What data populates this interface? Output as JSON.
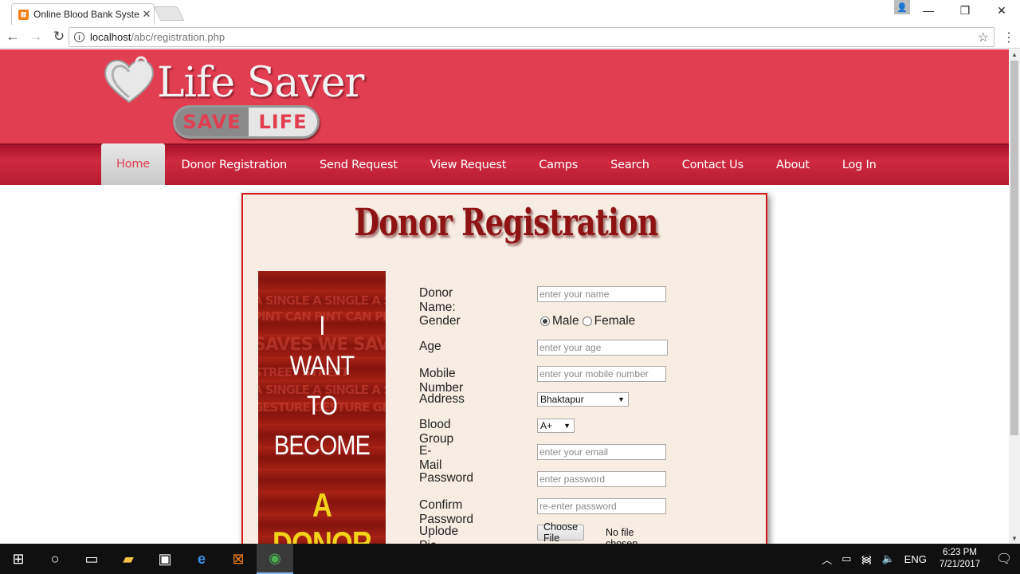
{
  "browser": {
    "tab_title": "Online Blood Bank System",
    "tab_close": "✕",
    "url_host": "localhost",
    "url_path": "/abc/registration.php",
    "back": "←",
    "forward": "→",
    "reload": "C",
    "minimize": "—",
    "restore": "❐",
    "close": "✕"
  },
  "header": {
    "logo_title": "Life Saver",
    "logo_pill_left": "SAVE",
    "logo_pill_right": "LIFE"
  },
  "nav": {
    "items": [
      {
        "label": "Home",
        "active": true
      },
      {
        "label": "Donor Registration"
      },
      {
        "label": "Send Request"
      },
      {
        "label": "View Request"
      },
      {
        "label": "Camps"
      },
      {
        "label": "Search"
      },
      {
        "label": "Contact Us"
      },
      {
        "label": "About"
      },
      {
        "label": "Log In"
      }
    ]
  },
  "panel": {
    "title": "Donor Registration",
    "poster": {
      "lines": [
        "I",
        "WANT",
        "TO",
        "BECOME"
      ],
      "highlight": "A DONOR",
      "bg_text": [
        "A SINGLE A SINGLE A SING",
        "PINT CAN PINT CAN PINT",
        "SAVES WE SAVE",
        "STREET STREET",
        "A SINGLE A SINGLE A SING",
        "GESTURE GESTURE GEST"
      ]
    }
  },
  "form": {
    "donor_name": {
      "label": "Donor Name:",
      "placeholder": "enter your name"
    },
    "gender": {
      "label": "Gender",
      "options": [
        "Male",
        "Female"
      ],
      "selected": "Male"
    },
    "age": {
      "label": "Age",
      "placeholder": "enter your age"
    },
    "mobile": {
      "label": "Mobile Number",
      "placeholder": "enter your mobile number"
    },
    "address": {
      "label": "Address",
      "value": "Bhaktapur"
    },
    "blood_group": {
      "label": "Blood Group",
      "value": "A+"
    },
    "email": {
      "label": "E-Mail",
      "placeholder": "enter your email"
    },
    "password": {
      "label": "Password",
      "placeholder": "enter password"
    },
    "confirm_password": {
      "label": "Confirm Password",
      "placeholder": "re-enter password"
    },
    "upload_pic": {
      "label": "Uplode Pic",
      "button": "Choose File",
      "status": "No file chosen"
    }
  },
  "taskbar": {
    "language": "ENG",
    "time": "6:23 PM",
    "date": "7/21/2017"
  },
  "colors": {
    "header_red": "#e23e51",
    "panel_bg": "#f7ede2",
    "title_red": "#8e1414",
    "donor_yellow": "#f3d21a"
  }
}
